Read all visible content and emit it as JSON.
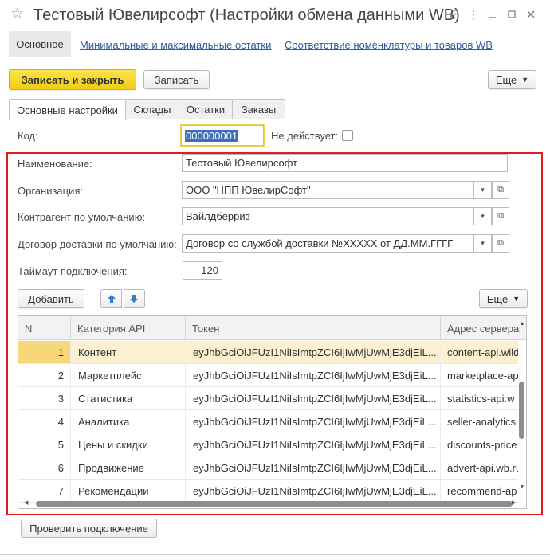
{
  "window": {
    "title": "Тестовый Ювелирсофт (Настройки обмена данными WB)",
    "icons": [
      "link-icon",
      "more-icon",
      "minimize-icon",
      "maximize-icon",
      "close-icon"
    ]
  },
  "nav": {
    "main": "Основное",
    "links": [
      "Минимальные и максимальные остатки",
      "Соответствие номенклатуры и товаров WB"
    ]
  },
  "toolbar": {
    "save_close": "Записать и закрыть",
    "save": "Записать",
    "more": "Еще"
  },
  "tabs": [
    "Основные настройки",
    "Склады",
    "Остатки",
    "Заказы"
  ],
  "form": {
    "code_label": "Код:",
    "code_value": "000000001",
    "inactive_label": "Не действует:",
    "name_label": "Наименование:",
    "name_value": "Тестовый Ювелирсофт",
    "org_label": "Организация:",
    "org_value": "ООО \"НПП ЮвелирСофт\"",
    "contractor_label": "Контрагент по умолчанию:",
    "contractor_value": "Вайлдберриз",
    "contract_label": "Договор доставки по умолчанию:",
    "contract_value": "Договор со службой доставки №XXXXX от ДД.ММ.ГГГГ",
    "timeout_label": "Таймаут подключения:",
    "timeout_value": "120"
  },
  "table_toolbar": {
    "add": "Добавить",
    "more": "Еще"
  },
  "table": {
    "headers": [
      "N",
      "Категория API",
      "Токен",
      "Адрес сервера"
    ],
    "rows": [
      [
        "1",
        "Контент",
        "eyJhbGciOiJFUzI1NiIsImtpZCI6IjIwMjUwMjE3djEiL...",
        "content-api.wild"
      ],
      [
        "2",
        "Маркетплейс",
        "eyJhbGciOiJFUzI1NiIsImtpZCI6IjIwMjUwMjE3djEiL...",
        "marketplace-ap"
      ],
      [
        "3",
        "Статистика",
        "eyJhbGciOiJFUzI1NiIsImtpZCI6IjIwMjUwMjE3djEiL...",
        "statistics-api.w"
      ],
      [
        "4",
        "Аналитика",
        "eyJhbGciOiJFUzI1NiIsImtpZCI6IjIwMjUwMjE3djEiL...",
        "seller-analytics"
      ],
      [
        "5",
        "Цены и скидки",
        "eyJhbGciOiJFUzI1NiIsImtpZCI6IjIwMjUwMjE3djEiL...",
        "discounts-price"
      ],
      [
        "6",
        "Продвижение",
        "eyJhbGciOiJFUzI1NiIsImtpZCI6IjIwMjUwMjE3djEiL...",
        "advert-api.wb.ru"
      ],
      [
        "7",
        "Рекомендации",
        "eyJhbGciOiJFUzI1NiIsImtpZCI6IjIwMjUwMjE3djEiL...",
        "recommend-ap"
      ]
    ]
  },
  "footer": {
    "check_connection": "Проверить подключение"
  },
  "colors": {
    "accent_yellow": "#f5d21e",
    "link_blue": "#2e5d9e",
    "highlight_frame": "#e31b1b",
    "selected_row": "#fbf0cf"
  }
}
